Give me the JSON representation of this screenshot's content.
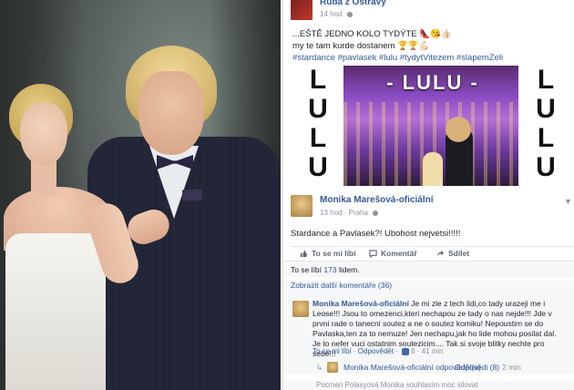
{
  "post1": {
    "author": "Ruda z Ostravy",
    "time": "14 hod",
    "line1": "...EŠTĚ JEDNO KOLO TYDÝTE 👠😘👍🏻",
    "line2": "my te tam kurde dostanem 🏆🏆💪🏻",
    "hashtags": "#stardance #pavlasek #lulu #tydytVitezem #slapemZeli",
    "image_title": "- LULU -",
    "image_side_text": "LULU"
  },
  "post2": {
    "author": "Monika Marešová-oficiální",
    "time": "13 hod",
    "location": "Praha",
    "text": "Stardance a Pavlasek?! Ubohost nejvetsi!!!!!",
    "menu_icon": "chevron-down-icon"
  },
  "actions": {
    "like": "To se mi líbí",
    "comment": "Komentář",
    "share": "Sdílet"
  },
  "likes": {
    "prefix": "To se líbí ",
    "count": "173",
    "suffix": " lidem."
  },
  "more_comments": "Zobrazit další komentáře (36)",
  "comment": {
    "author": "Monika Marešová-oficiální",
    "text": " Je mi zle z tech lidi,co tady urazeji me i Leose!!! Jsou to omezenci,kteri nechapou ze tady o nas nejde!!! Jde v prvni rade o tanecni soutez a ne o soutez komiku! Nepoustim se do Pavlaska,ten za to nemuze! Jen nechapu,jak ho lide mohou posilat dal. Je to nefer vuci ostatnim soutezicim.... Tak si svoje blitky nechte pro sebe!!!",
    "like_label": "To se mi líbí",
    "reply_label": "Odpovědět",
    "likes": "8",
    "time": "41 min"
  },
  "reply": {
    "text": "Monika Marešová-oficiální odpověděl(a)",
    "count": "Odpovědi (8)",
    "time": "2 min"
  },
  "cut_row": "Pocmen Polasyová Monika souhlasím moc silovat"
}
